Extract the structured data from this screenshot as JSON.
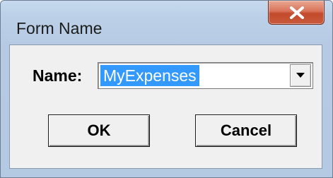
{
  "window": {
    "title": "Form Name",
    "close_icon": "close-x-icon"
  },
  "form": {
    "name_label": "Name:",
    "name_value": "MyExpenses",
    "dropdown_icon": "chevron-down-icon"
  },
  "buttons": {
    "ok_label": "OK",
    "cancel_label": "Cancel"
  },
  "colors": {
    "selection": "#3399ff",
    "close_button": "#c9593b",
    "frame": "#b6cbe3"
  }
}
